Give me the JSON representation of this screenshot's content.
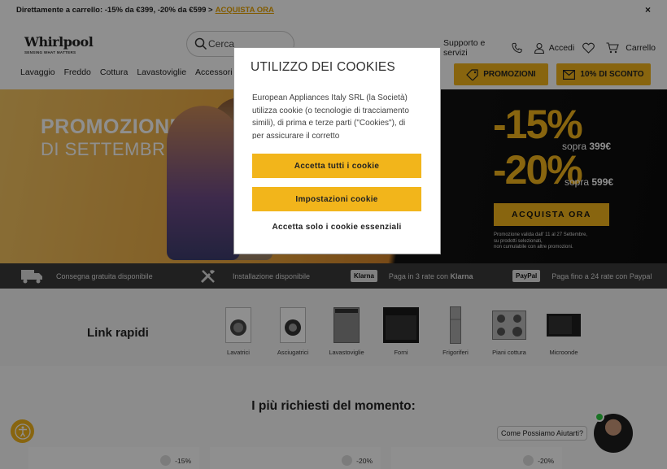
{
  "topbar": {
    "text": "Direttamente a carrello: -15% da €399, -20% da €599 >",
    "link": "ACQUISTA ORA",
    "close": "×"
  },
  "header": {
    "logo": {
      "word": "Whirlpool",
      "tagline": "SENSING WHAT MATTERS"
    },
    "search_placeholder": "Cerca",
    "support": "Supporto e servizi",
    "login": "Accedi",
    "cart": "Carrello",
    "nav": [
      "Lavaggio",
      "Freddo",
      "Cottura",
      "Lavastoviglie",
      "Accessori e"
    ],
    "promo_button": "PROMOZIONI",
    "discount_button": "10% DI SCONTO"
  },
  "hero": {
    "title_line1": "PROMOZIONE",
    "title_line2": "DI SETTEMBRE",
    "offer1": {
      "pct": "-15%",
      "sopra": "sopra",
      "price": "399€"
    },
    "offer2": {
      "pct": "-20%",
      "sopra": "sopra",
      "price": "599€"
    },
    "cta": "ACQUISTA ORA",
    "note_line1": "Promozione valida dall' 11 al 27 Settembre,",
    "note_line2": "su prodotti selezionati,",
    "note_line3": "non cumulabile con altre promozioni."
  },
  "strip": {
    "delivery": "Consegna gratuita disponibile",
    "install": "Installazione disponibile",
    "klarna_badge": "Klarna",
    "klarna_text": "Paga in 3 rate con",
    "klarna_brand": "Klarna",
    "paypal_badge": "PayPal",
    "paypal_text": "Paga fino a 24 rate con Paypal"
  },
  "quick": {
    "title": "Link rapidi",
    "items": [
      "Lavatrici",
      "Asciugatrici",
      "Lavastoviglie",
      "Forni",
      "Frigoriferi",
      "Piani cottura",
      "Microonde"
    ]
  },
  "most": {
    "title": "I più richiesti del momento:",
    "badges": [
      "-15%",
      "-20%",
      "-20%"
    ]
  },
  "chat": {
    "bubble": "Come Possiamo Aiutarti?"
  },
  "cookie": {
    "title": "UTILIZZO DEI COOKIES",
    "body": "European Appliances Italy SRL (la Società) utilizza cookie (o tecnologie di tracciamento simili), di prima e terze parti (\"Cookies\"), di per assicurare il corretto",
    "accept_all": "Accetta tutti i cookie",
    "settings": "Impostazioni cookie",
    "essential": "Accetta solo i cookie essenziali"
  },
  "colors": {
    "accent": "#f2b51b",
    "dark": "#3a3a3a",
    "overlay": "rgba(0,0,0,0.44)"
  }
}
